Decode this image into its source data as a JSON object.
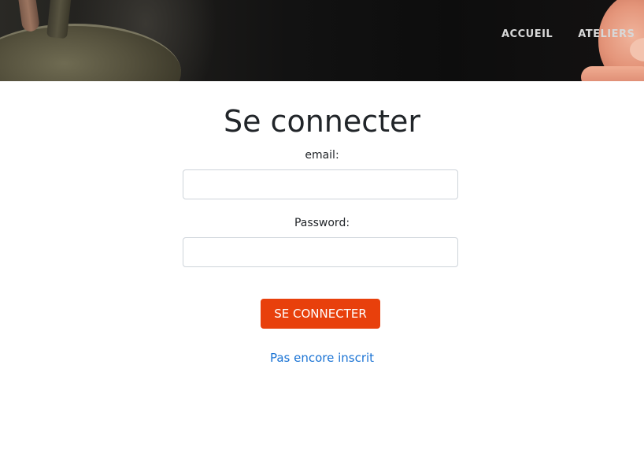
{
  "header": {
    "nav": [
      {
        "label": "ACCUEIL"
      },
      {
        "label": "ATELIERS"
      }
    ]
  },
  "login": {
    "title": "Se connecter",
    "email_label": "email:",
    "email_value": "",
    "password_label": "Password:",
    "password_value": "",
    "submit_label": "SE CONNECTER",
    "register_link": "Pas encore inscrit"
  },
  "colors": {
    "accent_button": "#e8400c",
    "link": "#1a73d4",
    "text": "#212529"
  }
}
